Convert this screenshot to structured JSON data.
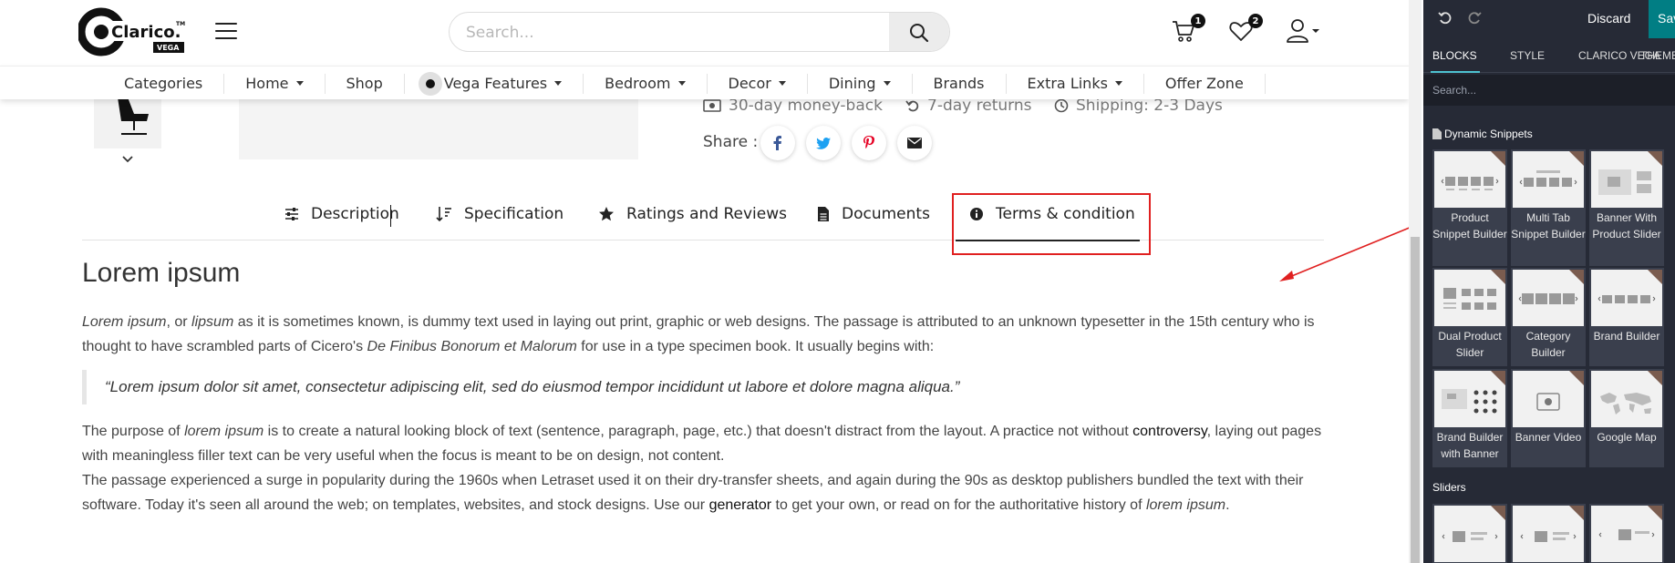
{
  "header": {
    "logo_text": "Clarico.",
    "logo_sub": "VEGA",
    "logo_tm": "TM",
    "search_placeholder": "Search...",
    "cart_count": "1",
    "wishlist_count": "2"
  },
  "menu": {
    "items": [
      {
        "label": "Categories",
        "dropdown": false
      },
      {
        "label": "Home",
        "dropdown": true
      },
      {
        "label": "Shop",
        "dropdown": false
      },
      {
        "label": "Vega Features",
        "dropdown": true
      },
      {
        "label": "Bedroom",
        "dropdown": true
      },
      {
        "label": "Decor",
        "dropdown": true
      },
      {
        "label": "Dining",
        "dropdown": true
      },
      {
        "label": "Brands",
        "dropdown": false
      },
      {
        "label": "Extra Links",
        "dropdown": true
      },
      {
        "label": "Offer Zone",
        "dropdown": false
      }
    ]
  },
  "product": {
    "features": [
      "30-day money-back",
      "7-day returns",
      "Shipping: 2-3 Days"
    ],
    "share_label": "Share :",
    "share_icons": [
      "facebook-icon",
      "twitter-icon",
      "pinterest-icon",
      "email-icon"
    ]
  },
  "tabs": {
    "description": "Description",
    "specification": "Specification",
    "ratings": "Ratings and Reviews",
    "documents": "Documents",
    "terms": "Terms & condition"
  },
  "content": {
    "heading": "Lorem ipsum",
    "p1_a": "Lorem ipsum",
    "p1_b": ", or ",
    "p1_c": "lipsum",
    "p1_d": " as it is sometimes known, is dummy text used in laying out print, graphic or web designs. The passage is attributed to an unknown typesetter in the 15th century who is thought to have scrambled parts of Cicero's ",
    "p1_e": "De Finibus Bonorum et Malorum",
    "p1_f": " for use in a type specimen book. It usually begins with:",
    "quote": "“Lorem ipsum dolor sit amet, consectetur adipiscing elit, sed do eiusmod tempor incididunt ut labore et dolore magna aliqua.”",
    "p2_a": "The purpose of ",
    "p2_b": "lorem ipsum",
    "p2_c": " is to create a natural looking block of text (sentence, paragraph, page, etc.) that doesn't distract from the layout. A practice not without ",
    "p2_d": "controversy",
    "p2_e": ", laying out pages with meaningless filler text can be very useful when the focus is meant to be on design, not content.",
    "p3_a": "The passage experienced a surge in popularity during the 1960s when Letraset used it on their dry-transfer sheets, and again during the 90s as desktop publishers bundled the text with their software. Today it's seen all around the web; on templates, websites, and stock designs. Use our ",
    "p3_b": "generator",
    "p3_c": " to get your own, or read on for the authoritative history of ",
    "p3_d": "lorem ipsum",
    "p3_e": "."
  },
  "editor": {
    "discard": "Discard",
    "save": "Save",
    "tabs": [
      "BLOCKS",
      "STYLE",
      "CLARICO VEGA",
      "THEME"
    ],
    "search_placeholder": "Search...",
    "section_dynamic": "Dynamic Snippets",
    "section_sliders": "Sliders",
    "snippets": [
      {
        "label": "Product Snippet Builder"
      },
      {
        "label": "Multi Tab Snippet Builder"
      },
      {
        "label": "Banner With Product Slider"
      },
      {
        "label": "Dual Product Slider"
      },
      {
        "label": "Category Builder"
      },
      {
        "label": "Brand Builder"
      },
      {
        "label": "Brand Builder with Banner"
      },
      {
        "label": "Banner Video"
      },
      {
        "label": "Google Map"
      }
    ]
  },
  "colors": {
    "accent_red": "#e02020",
    "editor_bg": "#262a36",
    "save_bg": "#017e84",
    "tab_underline": "#4ec3d1"
  }
}
